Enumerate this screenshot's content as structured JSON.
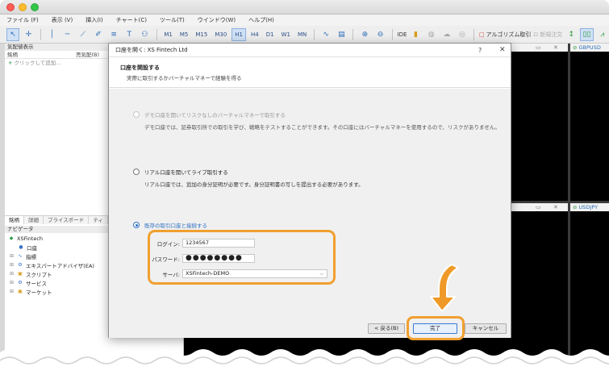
{
  "menu": [
    "ファイル (F)",
    "表示 (V)",
    "挿入(I)",
    "チャート(C)",
    "ツール(T)",
    "ウインドウ(W)",
    "ヘルプ(H)"
  ],
  "toolbar": {
    "timeframes": [
      "M1",
      "M5",
      "M15",
      "M30",
      "H1",
      "H4",
      "D1",
      "W1",
      "MN"
    ],
    "selected_timeframe": "H1",
    "ide_label": "IDE",
    "algo_label": "アルゴリズム取引",
    "new_order_label": "新規注文"
  },
  "market_watch": {
    "title": "気配値表示",
    "col_symbol": "銘柄",
    "col_bid": "売気配(B)",
    "add_text": "クリックして追加..."
  },
  "bottom_tabs": [
    "銘柄",
    "詳細",
    "プライスボード",
    "ティ"
  ],
  "navigator": {
    "title": "ナビゲータ",
    "items": [
      {
        "label": "XSFintech",
        "icon": "broker-icon"
      },
      {
        "label": "口座",
        "icon": "accounts-icon"
      },
      {
        "label": "指標",
        "icon": "indicators-icon"
      },
      {
        "label": "エキスパートアドバイザ(EA)",
        "icon": "expert-icon"
      },
      {
        "label": "スクリプト",
        "icon": "scripts-icon"
      },
      {
        "label": "サービス",
        "icon": "services-icon"
      },
      {
        "label": "マーケット",
        "icon": "market-icon"
      }
    ]
  },
  "charts": {
    "top_right": "GBPUSD",
    "bottom_right": "USDJPY"
  },
  "dialog": {
    "title": "口座を開く: XS Fintech Ltd",
    "help": "?",
    "close": "✕",
    "heading": "口座を開設する",
    "subheading": "実際に取引するかバーチャルマネーで経験を得る",
    "options": [
      {
        "label": "デモ口座を開いてリスクなしのバーチャルマネーで取引する",
        "desc": "デモ口座では、証券取引所での取引を学び、戦略をテストすることができます。その口座にはバーチャルマネーを使用するので、リスクがありません。",
        "state": "disabled"
      },
      {
        "label": "リアル口座を開いてライブ取引する",
        "desc": "リアル口座では、追加の身分証明が必要です。身分証明書の写しを提出する必要があります。",
        "state": "unchecked"
      },
      {
        "label": "既存の取引口座と接続する",
        "desc": "",
        "state": "checked"
      }
    ],
    "login_label": "ログイン:",
    "login_value": "1234567",
    "password_label": "パスワード:",
    "password_value": "●●●●●●●●",
    "server_label": "サーバ:",
    "server_value": "XSFintech-DEMO",
    "back_button": "< 戻る(B)",
    "finish_button": "完了",
    "cancel_button": "キャンセル"
  },
  "colors": {
    "highlight": "#f0a030",
    "accent": "#2c6fc0"
  }
}
